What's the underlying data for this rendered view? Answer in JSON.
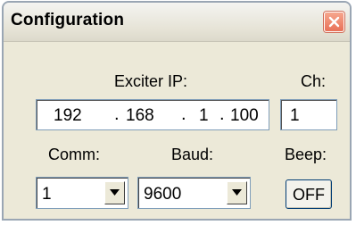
{
  "window": {
    "title": "Configuration"
  },
  "exciter_ip": {
    "label": "Exciter IP:",
    "octets": [
      "192",
      "168",
      "1",
      "100"
    ],
    "separator": "."
  },
  "channel": {
    "label": "Ch:",
    "value": "1"
  },
  "comm": {
    "label": "Comm:",
    "value": "1"
  },
  "baud": {
    "label": "Baud:",
    "value": "9600"
  },
  "beep": {
    "label": "Beep:",
    "button_label": "OFF"
  },
  "icons": {
    "close": "close-icon",
    "dropdown": "chevron-down-icon"
  },
  "colors": {
    "window_bg": "#ece9d8",
    "close_button": "#e87158",
    "field_border": "#7f9db9"
  }
}
